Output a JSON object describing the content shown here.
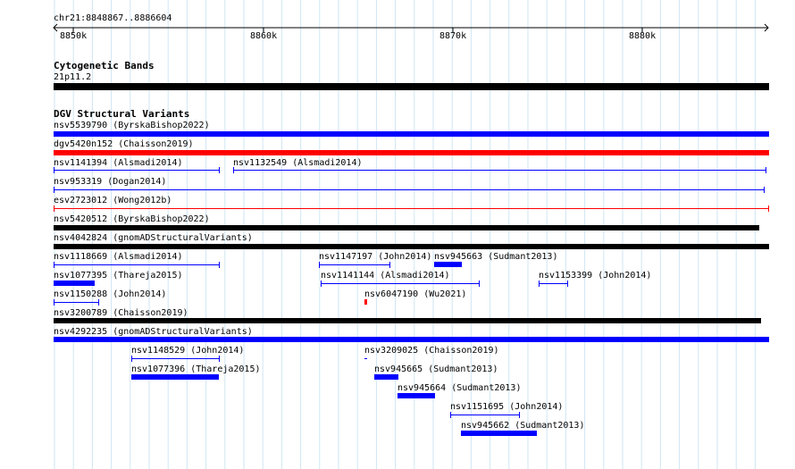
{
  "ruler": {
    "location": "chr21:8848867..8886604",
    "ticks": [
      "8850k",
      "8860k",
      "8870k",
      "8880k"
    ]
  },
  "cytobands": {
    "title": "Cytogenetic Bands",
    "band_label": "21p11.2"
  },
  "dgv": {
    "title": "DGV Structural Variants",
    "features": [
      {
        "label": "nsv5539790 (ByrskaBishop2022)",
        "color": "#0000ff",
        "style": "thick"
      },
      {
        "label": "dgv5420n152 (Chaisson2019)",
        "color": "#ff0000",
        "style": "thick"
      },
      {
        "label": "nsv1141394 (Alsmadi2014)",
        "color": "#0000ff",
        "style": "line"
      },
      {
        "label": "nsv1132549 (Alsmadi2014)",
        "color": "#0000ff",
        "style": "line"
      },
      {
        "label": "nsv953319 (Dogan2014)",
        "color": "#0000ff",
        "style": "line"
      },
      {
        "label": "esv2723012 (Wong2012b)",
        "color": "#ff0000",
        "style": "line"
      },
      {
        "label": "nsv5420512 (ByrskaBishop2022)",
        "color": "#000000",
        "style": "thick"
      },
      {
        "label": "nsv4042824 (gnomADStructuralVariants)",
        "color": "#000000",
        "style": "thick"
      },
      {
        "label": "nsv1118669 (Alsmadi2014)",
        "color": "#0000ff",
        "style": "line"
      },
      {
        "label": "nsv1147197 (John2014)",
        "color": "#0000ff",
        "style": "line"
      },
      {
        "label": "nsv945663 (Sudmant2013)",
        "color": "#0000ff",
        "style": "thick"
      },
      {
        "label": "nsv1077395 (Thareja2015)",
        "color": "#0000ff",
        "style": "thick"
      },
      {
        "label": "nsv1141144 (Alsmadi2014)",
        "color": "#0000ff",
        "style": "line"
      },
      {
        "label": "nsv1153399 (John2014)",
        "color": "#0000ff",
        "style": "line"
      },
      {
        "label": "nsv1150288 (John2014)",
        "color": "#0000ff",
        "style": "line"
      },
      {
        "label": "nsv6047190 (Wu2021)",
        "color": "#ff0000",
        "style": "thick"
      },
      {
        "label": "nsv3200789 (Chaisson2019)",
        "color": "#000000",
        "style": "thick"
      },
      {
        "label": "nsv4292235 (gnomADStructuralVariants)",
        "color": "#0000ff",
        "style": "thick"
      },
      {
        "label": "nsv1148529 (John2014)",
        "color": "#0000ff",
        "style": "line"
      },
      {
        "label": "nsv3209025 (Chaisson2019)",
        "color": "#0000ff",
        "style": "line"
      },
      {
        "label": "nsv1077396 (Thareja2015)",
        "color": "#0000ff",
        "style": "thick"
      },
      {
        "label": "nsv945665 (Sudmant2013)",
        "color": "#0000ff",
        "style": "thick"
      },
      {
        "label": "nsv945664 (Sudmant2013)",
        "color": "#0000ff",
        "style": "thick"
      },
      {
        "label": "nsv1151695 (John2014)",
        "color": "#0000ff",
        "style": "line"
      },
      {
        "label": "nsv945662 (Sudmant2013)",
        "color": "#0000ff",
        "style": "thick"
      }
    ]
  }
}
